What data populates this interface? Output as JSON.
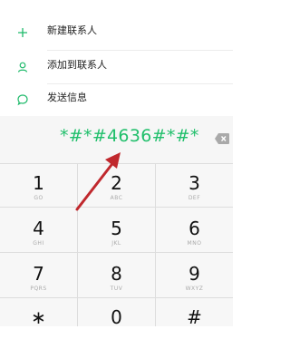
{
  "menu": {
    "items": [
      {
        "label": "新建联系人",
        "icon": "plus-icon"
      },
      {
        "label": "添加到联系人",
        "icon": "person-icon"
      },
      {
        "label": "发送信息",
        "icon": "message-icon"
      }
    ]
  },
  "dialer": {
    "number": "*#*#4636#*#*",
    "backspace_icon": "backspace-icon"
  },
  "keypad": {
    "keys": [
      {
        "digit": "1",
        "letters": "GO"
      },
      {
        "digit": "2",
        "letters": "ABC"
      },
      {
        "digit": "3",
        "letters": "DEF"
      },
      {
        "digit": "4",
        "letters": "GHI"
      },
      {
        "digit": "5",
        "letters": "JKL"
      },
      {
        "digit": "6",
        "letters": "MNO"
      },
      {
        "digit": "7",
        "letters": "PQRS"
      },
      {
        "digit": "8",
        "letters": "TUV"
      },
      {
        "digit": "9",
        "letters": "WXYZ"
      },
      {
        "digit": "∗",
        "letters": ""
      },
      {
        "digit": "0",
        "letters": ""
      },
      {
        "digit": "#",
        "letters": ""
      }
    ]
  },
  "colors": {
    "accent": "#20bf6b",
    "annotation_arrow": "#c0282d"
  }
}
